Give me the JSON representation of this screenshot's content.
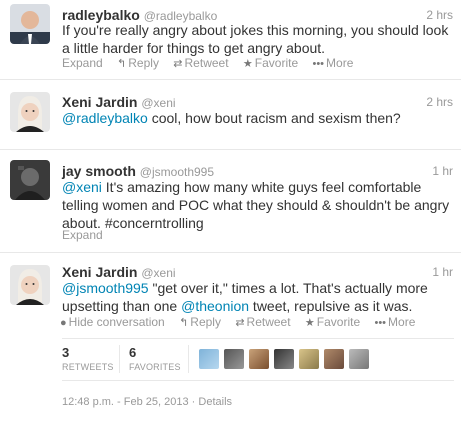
{
  "tweets": [
    {
      "fullname": "radleybalko",
      "username": "@radleybalko",
      "time": "2 hrs",
      "text": "If you're really angry about jokes this morning, you should look a little harder for things to get angry about.",
      "actions": {
        "expand": "Expand",
        "reply": "Reply",
        "retweet": "Retweet",
        "favorite": "Favorite",
        "more": "More"
      }
    },
    {
      "fullname": "Xeni Jardin",
      "username": "@xeni",
      "time": "2 hrs",
      "mention": "@radleybalko",
      "text_after": " cool, how bout racism and sexism then?"
    },
    {
      "fullname": "jay smooth",
      "username": "@jsmooth995",
      "time": "1 hr",
      "mention": "@xeni",
      "text_after": " It's amazing how many white guys feel comfortable telling women and POC what they should & shouldn't be angry about. #concerntrolling",
      "actions": {
        "expand": "Expand"
      }
    },
    {
      "fullname": "Xeni Jardin",
      "username": "@xeni",
      "time": "1 hr",
      "mention1": "@jsmooth995",
      "text_mid": " \"get over it,\" times a lot. That's actually more upsetting than one ",
      "mention2": "@theonion",
      "text_end": " tweet, repulsive as it was.",
      "actions": {
        "hide": "Hide conversation",
        "reply": "Reply",
        "retweet": "Retweet",
        "favorite": "Favorite",
        "more": "More"
      },
      "stats": {
        "retweets": "3",
        "retweets_label": "RETWEETS",
        "favorites": "6",
        "favorites_label": "FAVORITES"
      },
      "timestamp": "12:48 p.m. - Feb 25, 2013",
      "details": "Details"
    }
  ],
  "colors": {
    "link": "#0084b4",
    "muted": "#999999",
    "text": "#333333"
  }
}
